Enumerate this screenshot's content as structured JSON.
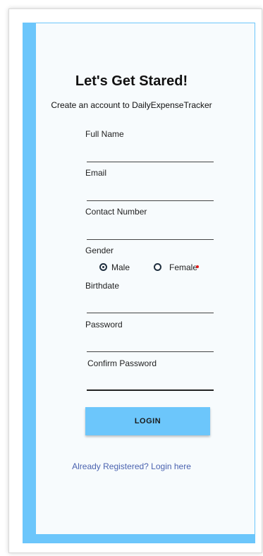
{
  "form": {
    "title": "Let's Get Stared!",
    "subtitle": "Create an account to DailyExpenseTracker",
    "fields": {
      "full_name": {
        "label": "Full Name",
        "value": ""
      },
      "email": {
        "label": "Email",
        "value": ""
      },
      "contact_number": {
        "label": "Contact Number",
        "value": ""
      },
      "birthdate": {
        "label": "Birthdate",
        "value": ""
      },
      "password": {
        "label": "Password",
        "value": ""
      },
      "confirm_password": {
        "label": "Confirm Password",
        "value": ""
      }
    },
    "gender": {
      "label": "Gender",
      "options": [
        {
          "label": "Male",
          "selected": true
        },
        {
          "label": "Female",
          "selected": false
        }
      ]
    },
    "login_button": "LOGIN",
    "login_link": "Already Registered? Login here"
  },
  "colors": {
    "accent": "#6cc6fb",
    "panel": "#f7fbfd",
    "link": "#4b63b0",
    "error_dot": "#e21a1a"
  }
}
